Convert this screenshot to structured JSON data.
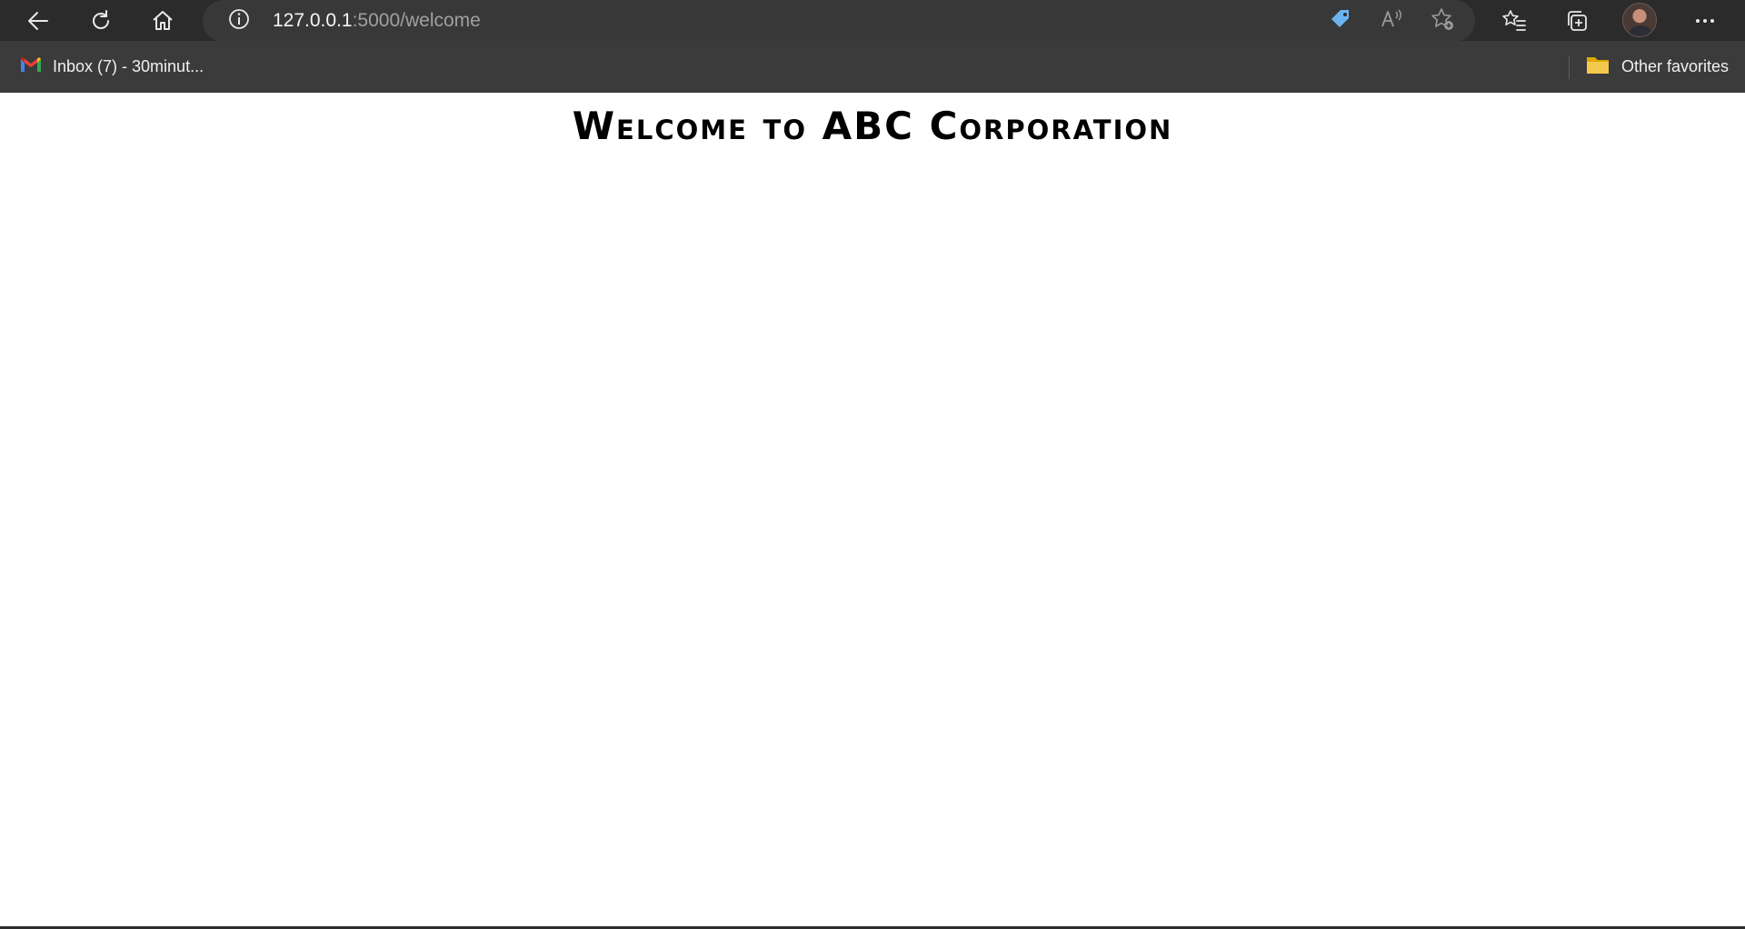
{
  "browser": {
    "url_host": "127.0.0.1",
    "url_path": ":5000/welcome",
    "icons": {
      "back": "back-arrow-icon",
      "refresh": "refresh-icon",
      "home": "home-icon",
      "site_info": "info-icon",
      "shopping": "tag-icon",
      "read_aloud": "read-aloud-icon",
      "add_favorite": "add-favorite-icon",
      "favorites": "favorites-icon",
      "collections": "collections-icon",
      "profile": "avatar",
      "menu": "more-icon"
    },
    "colors": {
      "toolbar_bg": "#2b2b2b",
      "address_bg": "#383838",
      "favorites_bg": "#3b3b3b",
      "tag_accent": "#6cb4f0",
      "folder_accent": "#f2c94c"
    }
  },
  "favorites": {
    "items": [
      {
        "label": "Inbox (7) - 30minut...",
        "icon": "gmail-icon"
      }
    ],
    "other_label": "Other favorites",
    "other_icon": "folder-icon"
  },
  "page": {
    "heading": "Welcome to ABC Corporation"
  }
}
